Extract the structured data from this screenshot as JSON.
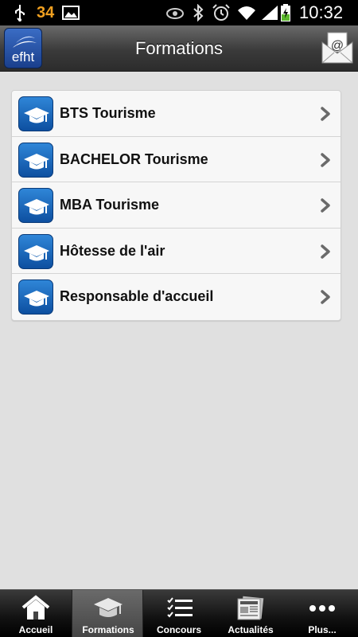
{
  "status_bar": {
    "temperature": "34",
    "time": "10:32",
    "icons": [
      "usb-icon",
      "picture-icon",
      "eye-icon",
      "bluetooth-icon",
      "alarm-icon",
      "wifi-icon",
      "signal-icon",
      "battery-icon"
    ]
  },
  "header": {
    "logo_text": "efht",
    "title": "Formations"
  },
  "formations": [
    {
      "label": "BTS Tourisme"
    },
    {
      "label": "BACHELOR Tourisme"
    },
    {
      "label": "MBA Tourisme"
    },
    {
      "label": "Hôtesse de l'air"
    },
    {
      "label": "Responsable d'accueil"
    }
  ],
  "tabs": [
    {
      "label": "Accueil",
      "icon": "home-icon",
      "active": false
    },
    {
      "label": "Formations",
      "icon": "graduation-cap-icon",
      "active": true
    },
    {
      "label": "Concours",
      "icon": "checklist-icon",
      "active": false
    },
    {
      "label": "Actualités",
      "icon": "newspaper-icon",
      "active": false
    },
    {
      "label": "Plus...",
      "icon": "more-icon",
      "active": false
    }
  ],
  "colors": {
    "accent_blue": "#1a5fb4",
    "temperature": "#f0a020"
  }
}
